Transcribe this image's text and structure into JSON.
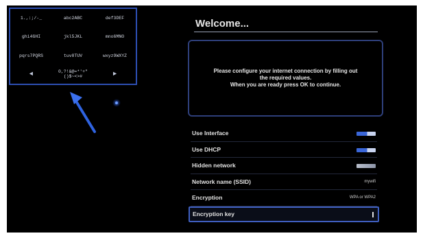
{
  "keypad": {
    "keys": [
      {
        "label": "1.,:;/-_"
      },
      {
        "label": "abc2ABC"
      },
      {
        "label": "def3DEF"
      },
      {
        "label": "ghi4GHI"
      },
      {
        "label": "jkl5JKL"
      },
      {
        "label": "mno6MNO"
      },
      {
        "label": "pqrs7PQRS"
      },
      {
        "label": "tuv8TUV"
      },
      {
        "label": "wxyz9WXYZ"
      },
      {
        "label": "◄",
        "icon": "arrow-left-icon"
      },
      {
        "label": "0,?!&@=*'+\"\n()$~<>#"
      },
      {
        "label": "►",
        "icon": "arrow-right-icon"
      }
    ]
  },
  "welcome": {
    "title": "Welcome..."
  },
  "info": {
    "text": "Please configure your internet connection by filling out\nthe required values.\nWhen you are ready press OK to continue."
  },
  "settings": {
    "use_interface": {
      "label": "Use Interface",
      "enabled": true
    },
    "use_dhcp": {
      "label": "Use DHCP",
      "enabled": true
    },
    "hidden_network": {
      "label": "Hidden network",
      "enabled": false
    },
    "ssid": {
      "label": "Network name (SSID)",
      "value": "mywifi"
    },
    "encryption": {
      "label": "Encryption",
      "value": "WPA or WPA2"
    },
    "encryption_key": {
      "label": "Encryption key",
      "value": ""
    }
  },
  "colors": {
    "accent": "#3a66d8",
    "frame": "#2d4fb4",
    "background": "#000000"
  }
}
